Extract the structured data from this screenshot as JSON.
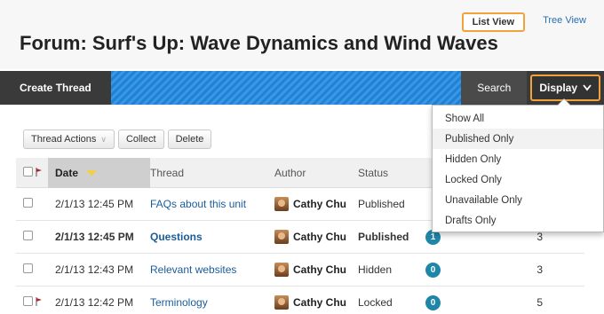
{
  "header": {
    "view_toggle": {
      "list_view": "List View",
      "tree_view": "Tree View"
    },
    "title": "Forum: Surf's Up: Wave Dynamics and Wind Waves"
  },
  "action_bar": {
    "create_thread": "Create Thread",
    "search": "Search",
    "display": "Display"
  },
  "display_menu": {
    "items": [
      "Show All",
      "Published Only",
      "Hidden Only",
      "Locked Only",
      "Unavailable Only",
      "Drafts Only"
    ],
    "highlighted": "Published Only"
  },
  "toolbar": {
    "thread_actions": "Thread Actions",
    "collect": "Collect",
    "delete": "Delete"
  },
  "table": {
    "headers": {
      "date": "Date",
      "thread": "Thread",
      "author": "Author",
      "status": "Status"
    },
    "rows": [
      {
        "date": "2/1/13 12:45 PM",
        "thread": "FAQs about this unit",
        "author": "Cathy Chu",
        "status": "Published",
        "flagged": false,
        "bold": false,
        "badge": "",
        "total": ""
      },
      {
        "date": "2/1/13 12:45 PM",
        "thread": "Questions",
        "author": "Cathy Chu",
        "status": "Published",
        "flagged": false,
        "bold": true,
        "badge": "1",
        "total": "3"
      },
      {
        "date": "2/1/13 12:43 PM",
        "thread": "Relevant websites",
        "author": "Cathy Chu",
        "status": "Hidden",
        "flagged": false,
        "bold": false,
        "badge": "0",
        "total": "3"
      },
      {
        "date": "2/1/13 12:42 PM",
        "thread": "Terminology",
        "author": "Cathy Chu",
        "status": "Locked",
        "flagged": true,
        "bold": false,
        "badge": "0",
        "total": "5"
      }
    ]
  },
  "colors": {
    "accent_orange": "#f4a13a",
    "action_bar": "#3a3a3a",
    "stripe_blue": "#1f82d6",
    "link_blue": "#1a5c9a",
    "badge_teal": "#1f86a8",
    "flag_red": "#b5202a"
  }
}
